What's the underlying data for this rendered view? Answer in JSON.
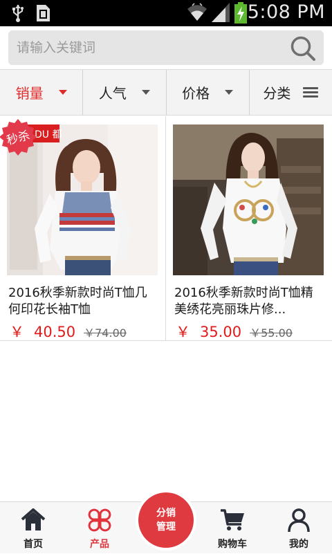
{
  "status_bar": {
    "time": "5:08 PM",
    "icons": [
      "usb-icon",
      "sim-icon",
      "wifi-icon",
      "signal-icon",
      "battery-charging-icon"
    ]
  },
  "search": {
    "placeholder": "请输入关键词",
    "value": "",
    "icon": "search-icon"
  },
  "filters": [
    {
      "label": "销量",
      "active": true,
      "icon": "caret-down-icon"
    },
    {
      "label": "人气",
      "active": false,
      "icon": "caret-down-icon"
    },
    {
      "label": "价格",
      "active": false,
      "icon": "caret-down-icon"
    },
    {
      "label": "分类",
      "active": false,
      "icon": "menu-icon"
    }
  ],
  "products": [
    {
      "title": "2016秋季新款时尚T恤几何印花长袖T恤",
      "price_symbol": "￥",
      "price": "40.50",
      "original_price": "￥74.00",
      "badge": "秒杀",
      "photo_text": "DU 都"
    },
    {
      "title": "2016秋季新款时尚T恤精美绣花亮丽珠片修...",
      "price_symbol": "￥",
      "price": "35.00",
      "original_price": "￥55.00"
    }
  ],
  "bottom_nav": {
    "items": [
      {
        "label": "首页",
        "icon": "home-icon",
        "active": false
      },
      {
        "label": "产品",
        "icon": "products-icon",
        "active": true
      },
      {
        "label": "购物车",
        "icon": "cart-icon",
        "active": false
      },
      {
        "label": "我的",
        "icon": "user-icon",
        "active": false
      }
    ],
    "center": {
      "line1": "分销",
      "line2": "管理"
    }
  },
  "colors": {
    "accent": "#e02a2a",
    "center_button": "#df3a3f",
    "status_bar": "#000000",
    "search_bg": "#e5e5e5",
    "filter_bg": "#f3f3f3"
  }
}
